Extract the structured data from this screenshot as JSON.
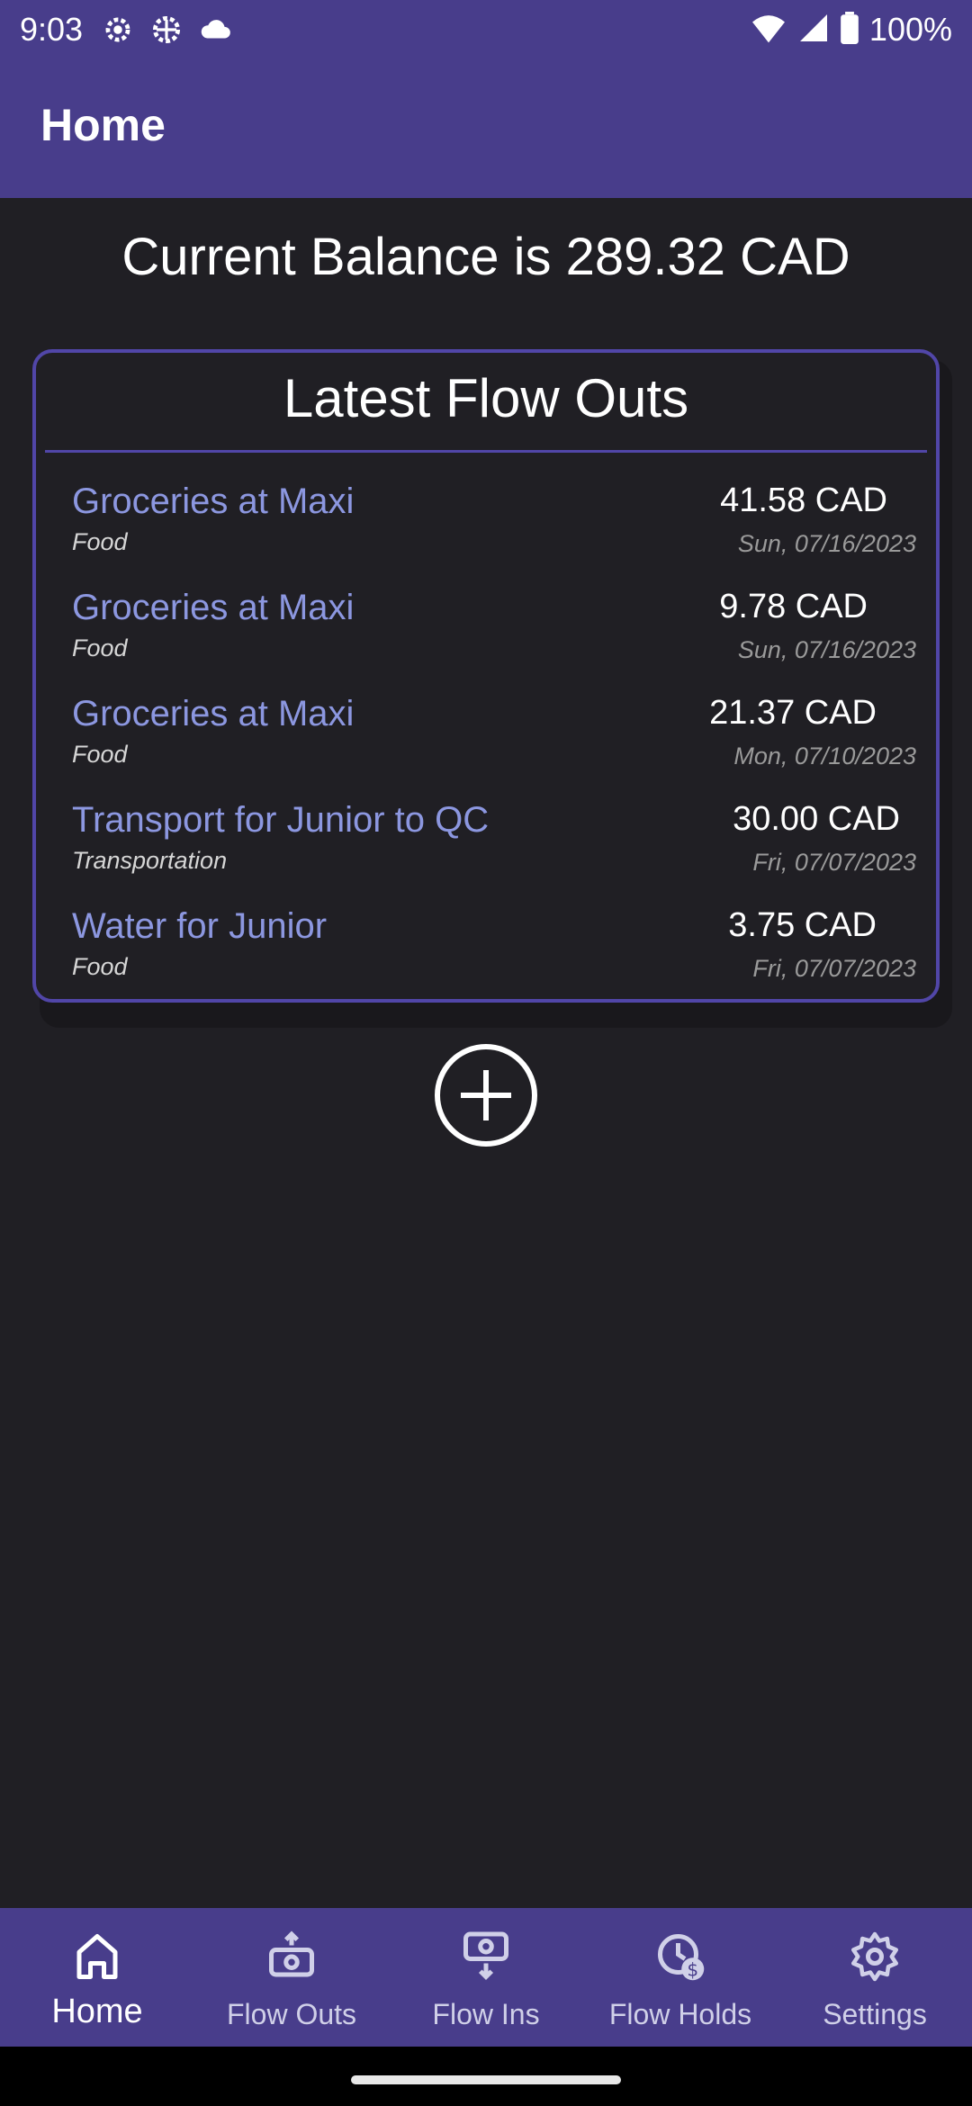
{
  "status_bar": {
    "time": "9:03",
    "battery_percent": "100%"
  },
  "app_bar": {
    "title": "Home"
  },
  "balance_text": "Current Balance is 289.32 CAD",
  "flow_outs_card": {
    "title": "Latest Flow Outs",
    "items": [
      {
        "title": "Groceries at Maxi",
        "category": "Food",
        "amount": "41.58 CAD",
        "date": "Sun, 07/16/2023"
      },
      {
        "title": "Groceries at Maxi",
        "category": "Food",
        "amount": "9.78 CAD",
        "date": "Sun, 07/16/2023"
      },
      {
        "title": "Groceries at Maxi",
        "category": "Food",
        "amount": "21.37 CAD",
        "date": "Mon, 07/10/2023"
      },
      {
        "title": "Transport for Junior to QC",
        "category": "Transportation",
        "amount": "30.00 CAD",
        "date": "Fri, 07/07/2023"
      },
      {
        "title": "Water for Junior",
        "category": "Food",
        "amount": "3.75 CAD",
        "date": "Fri, 07/07/2023"
      }
    ]
  },
  "bottom_nav": {
    "items": [
      {
        "label": "Home",
        "icon": "home-icon",
        "active": true
      },
      {
        "label": "Flow Outs",
        "icon": "money-out-icon",
        "active": false
      },
      {
        "label": "Flow Ins",
        "icon": "money-in-icon",
        "active": false
      },
      {
        "label": "Flow Holds",
        "icon": "clock-dollar-icon",
        "active": false
      },
      {
        "label": "Settings",
        "icon": "gear-icon",
        "active": false
      }
    ]
  },
  "colors": {
    "primary": "#483d8b",
    "background": "#201f24",
    "accent_text": "#8c97e0",
    "card_border": "#5146a8"
  }
}
